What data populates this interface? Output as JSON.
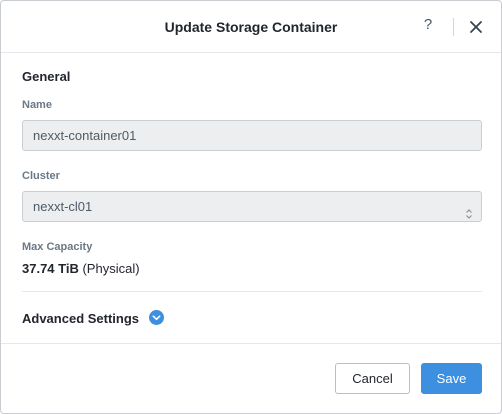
{
  "dialog": {
    "title": "Update Storage Container",
    "help_label": "?"
  },
  "general": {
    "section_title": "General",
    "name_label": "Name",
    "name_value": "nexxt-container01",
    "cluster_label": "Cluster",
    "cluster_value": "nexxt-cl01",
    "max_capacity_label": "Max Capacity",
    "max_capacity_value": "37.74 TiB",
    "max_capacity_suffix": " (Physical)"
  },
  "advanced": {
    "label": "Advanced Settings",
    "icon": "chevron-down-circle-icon"
  },
  "footer": {
    "cancel_label": "Cancel",
    "save_label": "Save"
  },
  "colors": {
    "accent": "#3d8fe0",
    "field_bg": "#eceef0",
    "label": "#6b7886"
  }
}
